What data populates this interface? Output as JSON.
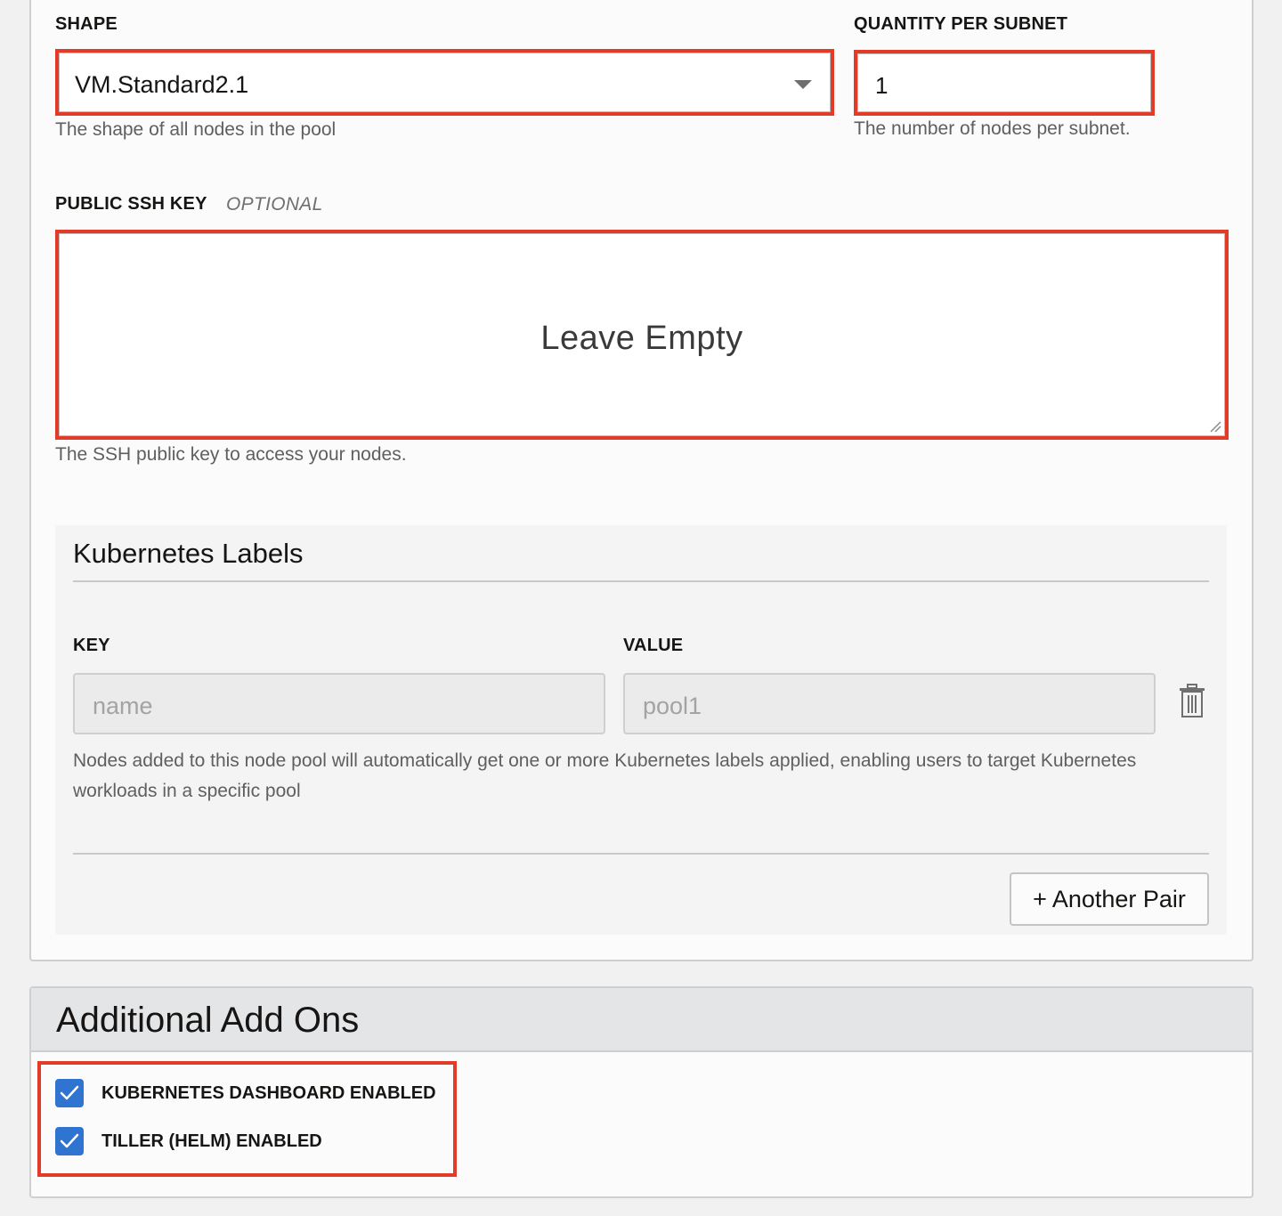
{
  "shape": {
    "label": "SHAPE",
    "value": "VM.Standard2.1",
    "help": "The shape of all nodes in the pool"
  },
  "quantity": {
    "label": "QUANTITY PER SUBNET",
    "value": "1",
    "help": "The number of nodes per subnet."
  },
  "ssh": {
    "label": "PUBLIC SSH KEY",
    "optional": "OPTIONAL",
    "annotation": "Leave Empty",
    "help": "The SSH public key to access your nodes."
  },
  "kubernetes_labels": {
    "title": "Kubernetes Labels",
    "key_label": "KEY",
    "value_label": "VALUE",
    "key_placeholder": "name",
    "value_placeholder": "pool1",
    "help": "Nodes added to this node pool will automatically get one or more Kubernetes labels applied, enabling users to target Kubernetes workloads in a specific pool",
    "add_button": "+ Another Pair"
  },
  "addons": {
    "title": "Additional Add Ons",
    "options": [
      {
        "label": "KUBERNETES DASHBOARD ENABLED",
        "checked": true
      },
      {
        "label": "TILLER (HELM) ENABLED",
        "checked": true
      }
    ]
  },
  "colors": {
    "highlight": "#e23b27",
    "checkbox": "#2f74d0"
  },
  "icons": {
    "dropdown": "chevron-down-icon",
    "delete": "trash-icon",
    "check": "check-icon",
    "resize": "resize-grip-icon"
  }
}
